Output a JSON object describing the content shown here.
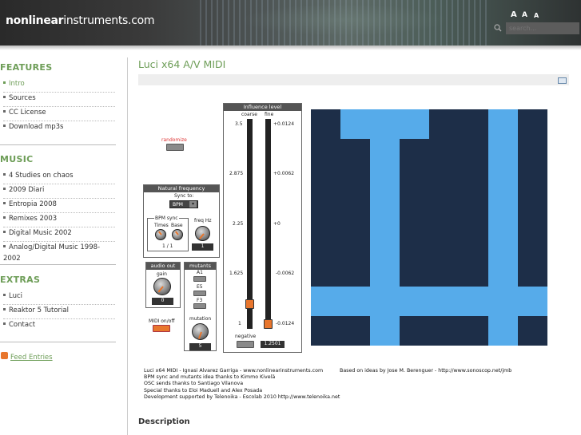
{
  "header": {
    "site_title_bold": "nonlinear",
    "site_title_rest": "instruments.com",
    "font_size_labels": [
      "A",
      "A",
      "A"
    ],
    "search_placeholder": "search..."
  },
  "sidebar": {
    "sections": [
      {
        "title": "FEATURES",
        "items": [
          "Intro",
          "Sources",
          "CC License",
          "Download mp3s"
        ],
        "active": "Intro"
      },
      {
        "title": "MUSIC",
        "items": [
          "4 Studies on chaos",
          "2009 Diari",
          "Entropia 2008",
          "Remixes 2003",
          "Digital Music 2002",
          "Analog/Digital Music 1998-2002"
        ]
      },
      {
        "title": "EXTRAS",
        "items": [
          "Luci",
          "Reaktor 5 Tutorial",
          "Contact"
        ]
      }
    ],
    "feed_label": "Feed Entries"
  },
  "main": {
    "title": "Luci x64 A/V MIDI",
    "description_heading": "Description"
  },
  "patch": {
    "randomize_label": "randomize",
    "natural_frequency": {
      "title": "Natural frequency",
      "sync_to": "Sync to:",
      "sync_value": "BPM",
      "bpm_sync": "BPM sync",
      "times": "Times",
      "base": "Base",
      "ratio": "1 / 1",
      "freq_hz": "freq Hz",
      "freq_value": "1"
    },
    "audio_out": {
      "title": "audio out",
      "gain": "gain",
      "gain_value": "0"
    },
    "midi_label": "MIDI on/off",
    "mutants": {
      "title": "mutants",
      "labels": [
        "A1",
        "E5",
        "F3"
      ],
      "mutation": "mutation",
      "mutation_value": "5"
    },
    "influence": {
      "title": "Influence level",
      "coarse": "coarse",
      "fine": "fine",
      "coarse_ticks": [
        "3.5",
        "2.875",
        "2.25",
        "1.625",
        "1"
      ],
      "fine_ticks": [
        "+0.0124",
        "+0.0062",
        "+0",
        "-0.0062",
        "-0.0124"
      ],
      "coarse_level": 0.1,
      "fine_level": 0.0,
      "negative": "negative",
      "value": "1.2501"
    }
  },
  "credits": {
    "left": [
      "Luci x64 MIDI - Ignasi Alvarez Garriga - www.nonlinearinstruments.com",
      "BPM sync and mutants idea thanks to Kimmo Kivelä",
      "OSC sends thanks to Santiago Vilanova",
      "Special thanks to Eloi Maduell and Alex Posada",
      "Development supported by Telenoika - Escolab 2010  http://www.telenoika.net"
    ],
    "right": "Based on ideas by Jose M. Berenguer - http://www.sonoscop.net/jmb"
  },
  "colors": {
    "accent_green": "#6d9d57",
    "viz_dark": "#1d2e48",
    "viz_light": "#56abea",
    "orange": "#e8762d"
  }
}
